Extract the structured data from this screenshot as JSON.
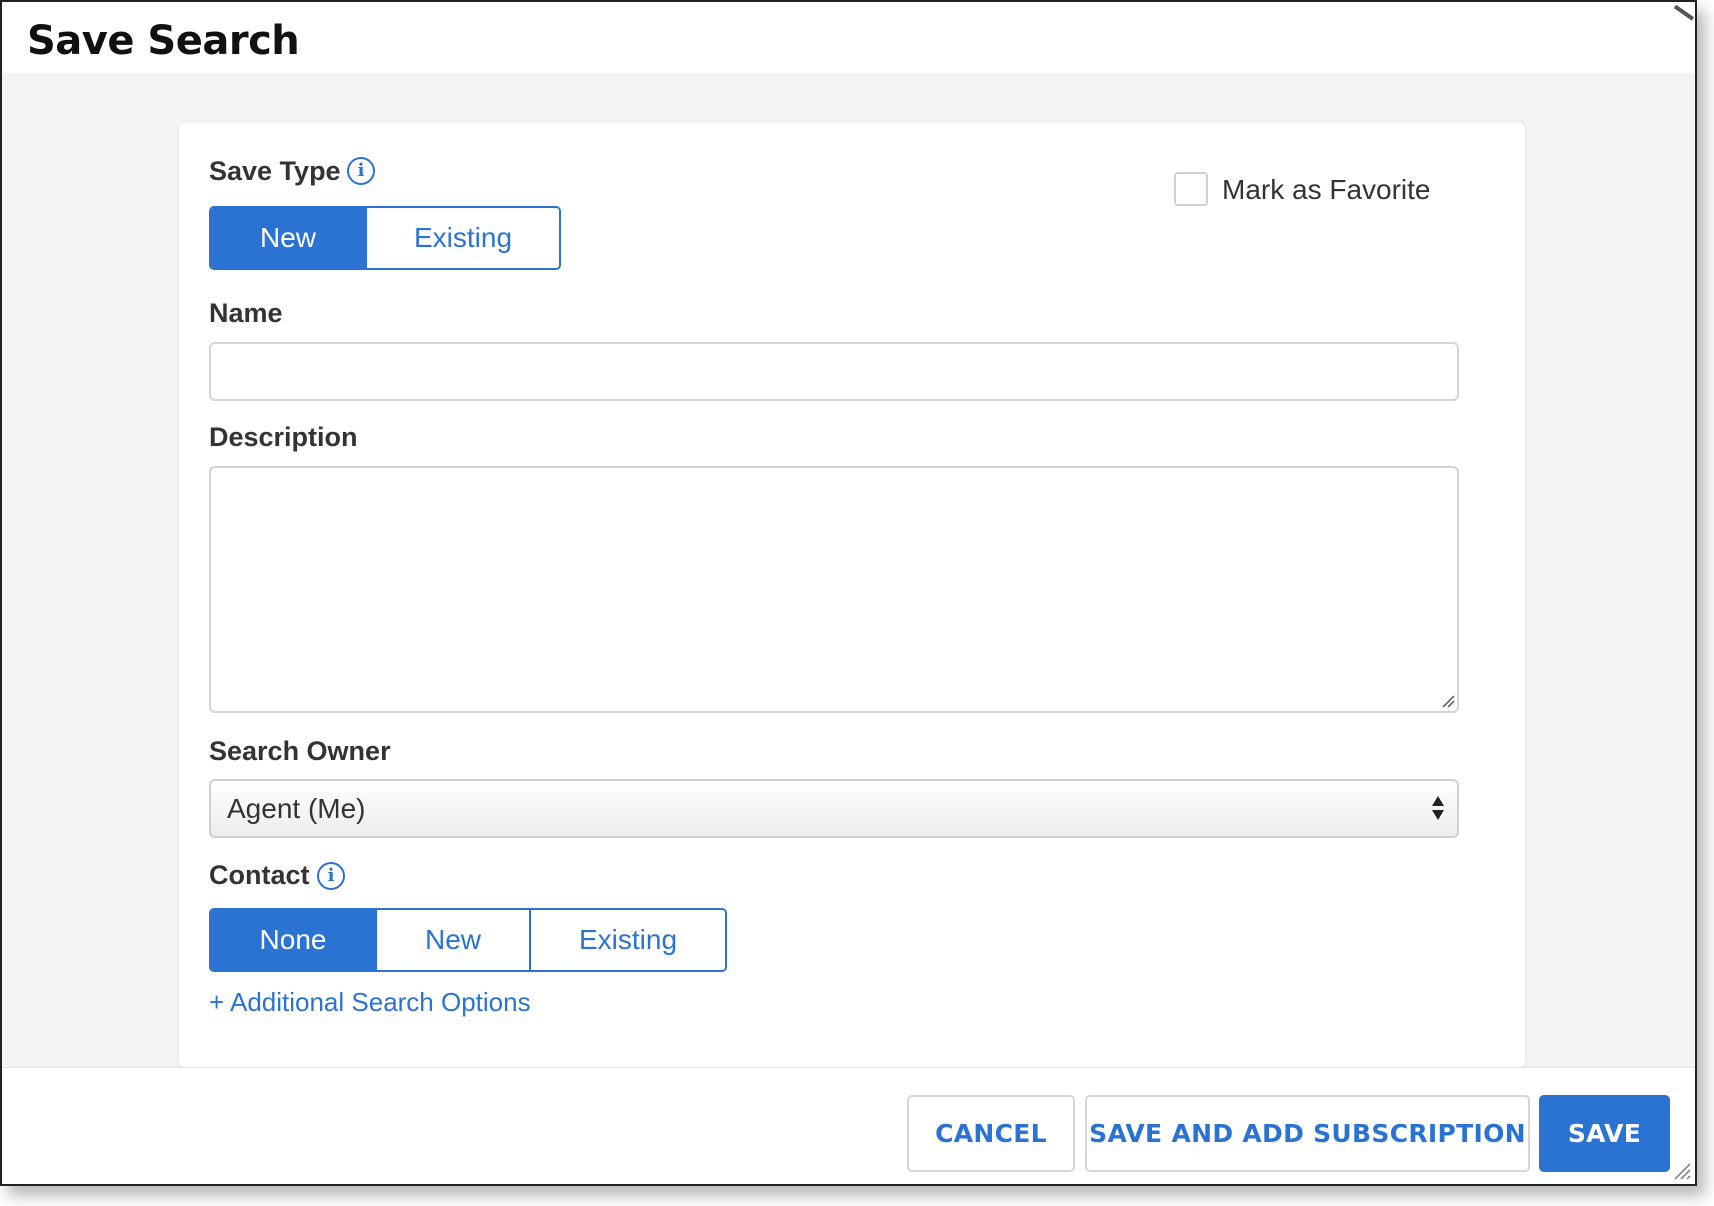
{
  "dialog": {
    "title": "Save Search"
  },
  "form": {
    "save_type": {
      "label": "Save Type",
      "options": [
        "New",
        "Existing"
      ],
      "selected": "New"
    },
    "mark_favorite": {
      "label": "Mark as Favorite",
      "checked": false
    },
    "name": {
      "label": "Name",
      "value": ""
    },
    "description": {
      "label": "Description",
      "value": ""
    },
    "search_owner": {
      "label": "Search Owner",
      "value": "Agent (Me)"
    },
    "contact": {
      "label": "Contact",
      "options": [
        "None",
        "New",
        "Existing"
      ],
      "selected": "None"
    },
    "additional_options_link": "+ Additional Search Options"
  },
  "footer": {
    "cancel_label": "CANCEL",
    "save_and_subscribe_label": "SAVE AND ADD SUBSCRIPTION",
    "save_label": "SAVE"
  },
  "icons": {
    "info": "info-icon",
    "select": "sort-arrows-icon",
    "resize": "resize-grip-icon"
  },
  "colors": {
    "accent": "#2b73d2",
    "panel_background": "#f3f3f3",
    "text": "#333333"
  }
}
